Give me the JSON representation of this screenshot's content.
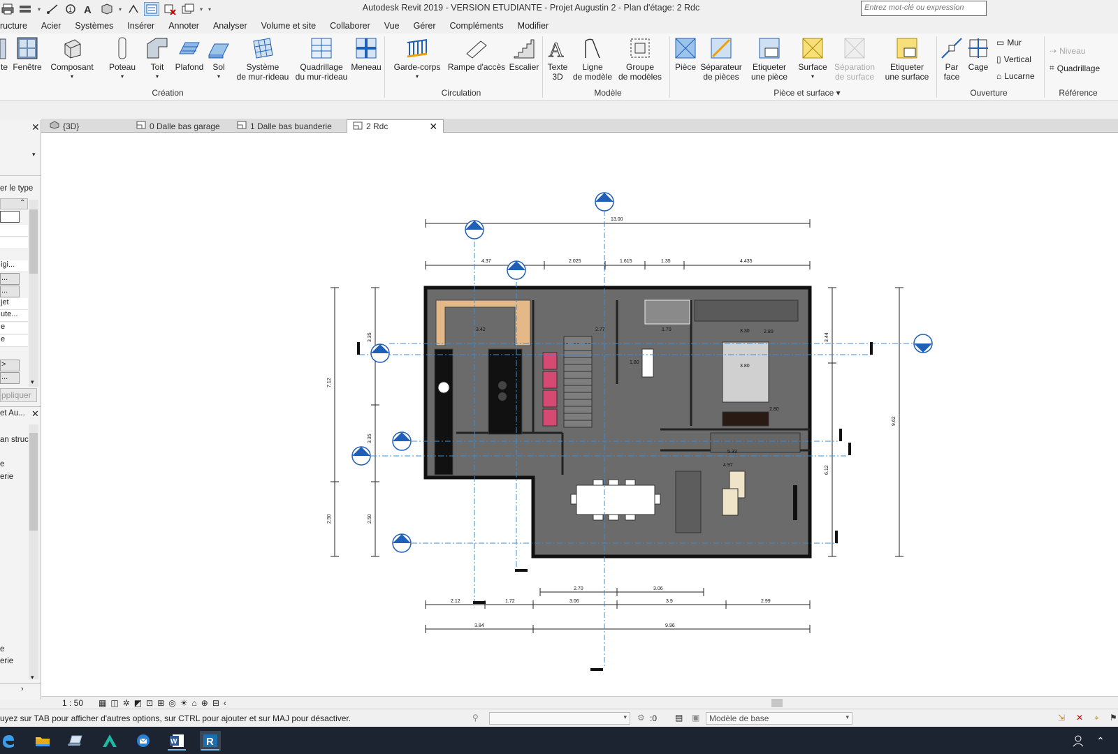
{
  "window": {
    "title": "Autodesk Revit 2019 - VERSION ETUDIANTE - Projet Augustin 2 - Plan d'étage: 2 Rdc",
    "search_placeholder": "Entrez mot-clé ou expression"
  },
  "quick_access": [
    "open-icon",
    "print-icon",
    "measure-icon",
    "dimension-icon",
    "tag-icon",
    "text-icon",
    "3d-view-icon",
    "section-icon",
    "thin-lines-icon",
    "close-hidden-icon",
    "switch-windows-icon",
    "dropdown-icon"
  ],
  "menu": {
    "tabs": [
      "ructure",
      "Acier",
      "Systèmes",
      "Insérer",
      "Annoter",
      "Analyser",
      "Volume et site",
      "Collaborer",
      "Vue",
      "Gérer",
      "Compléments",
      "Modifier"
    ]
  },
  "ribbon": {
    "creation": {
      "label": "Création",
      "buttons": [
        "te",
        "Fenêtre",
        "Composant",
        "Poteau",
        "Toit",
        "Plafond",
        "Sol",
        "Système\nde mur-rideau",
        "Quadrillage\ndu mur-rideau",
        "Meneau"
      ]
    },
    "circulation": {
      "label": "Circulation",
      "buttons": [
        "Garde-corps",
        "Rampe d'accès",
        "Escalier"
      ]
    },
    "modele": {
      "label": "Modèle",
      "buttons": [
        "Texte\n3D",
        "Ligne\nde modèle",
        "Groupe\nde modèles"
      ]
    },
    "piece": {
      "label": "Pièce et surface",
      "buttons": [
        "Pièce",
        "Séparateur\nde pièces",
        "Etiqueter\nune pièce",
        "Surface",
        "Séparation\nde surface",
        "Etiqueter\nune surface"
      ]
    },
    "ouverture": {
      "label": "Ouverture",
      "buttons": [
        "Par\nface",
        "Cage"
      ],
      "small": [
        "Mur",
        "Vertical",
        "Lucarne"
      ]
    },
    "reference": {
      "label": "Référence",
      "small": [
        "Niveau",
        "Quadrillage"
      ]
    }
  },
  "left_panel": {
    "filter_label": "er le type",
    "rows": [
      "",
      "",
      "",
      "igi...",
      "...",
      "...",
      "jet",
      "ute...",
      "e",
      "e",
      ">",
      "..."
    ],
    "apply_label": "ppliquer",
    "browser_title": "et Au...",
    "browser_items": [
      "an struc",
      "e",
      "erie"
    ],
    "browser_items_bottom": [
      "e",
      "erie"
    ]
  },
  "view_tabs": [
    {
      "label": "{3D}",
      "icon": "3d-view-icon"
    },
    {
      "label": "0 Dalle bas garage",
      "icon": "floor-plan-icon"
    },
    {
      "label": "1 Dalle bas buanderie",
      "icon": "floor-plan-icon"
    },
    {
      "label": "2 Rdc",
      "icon": "floor-plan-icon",
      "active": true
    }
  ],
  "plan": {
    "dims_top_overall": "13.00",
    "dims_top": [
      "4.37",
      "2.025",
      "1.615",
      "1.35",
      "4.435"
    ],
    "dims_bottom_1": [
      "2.70",
      "3.06"
    ],
    "dims_bottom_2": [
      "2.12",
      "1.72",
      "3.06",
      "3.9",
      "2.99"
    ],
    "dims_bottom_3": [
      "3.84",
      "9.96"
    ],
    "dims_left": [
      "7.12",
      "2.50"
    ],
    "dims_left_inner": [
      "3.35",
      "3.35",
      "2.50"
    ],
    "dims_right": [
      "9.62"
    ],
    "dims_right_inner": [
      "3.44",
      "6.12"
    ],
    "room_dims": [
      "3.42",
      "2.77",
      "1.70",
      "3.30",
      "2.80",
      "3.80",
      "4.97",
      "5.33",
      "1.80",
      "2.80"
    ]
  },
  "view_control": {
    "scale": "1 : 50"
  },
  "status": {
    "message": "uyez sur TAB pour afficher d'autres options, sur CTRL pour ajouter et sur MAJ pour désactiver.",
    "workset_value": ":0",
    "design_option": "Modèle de base"
  },
  "taskbar": [
    "edge-icon",
    "explorer-icon",
    "laptop-icon",
    "autocad-icon",
    "outlook-icon",
    "word-icon",
    "revit-icon"
  ],
  "colors": {
    "accent_blue": "#1f5fb8",
    "grid_blue": "#3a8fd8",
    "floor_grey": "#6b6b6b",
    "taskbar": "#1b2430"
  }
}
